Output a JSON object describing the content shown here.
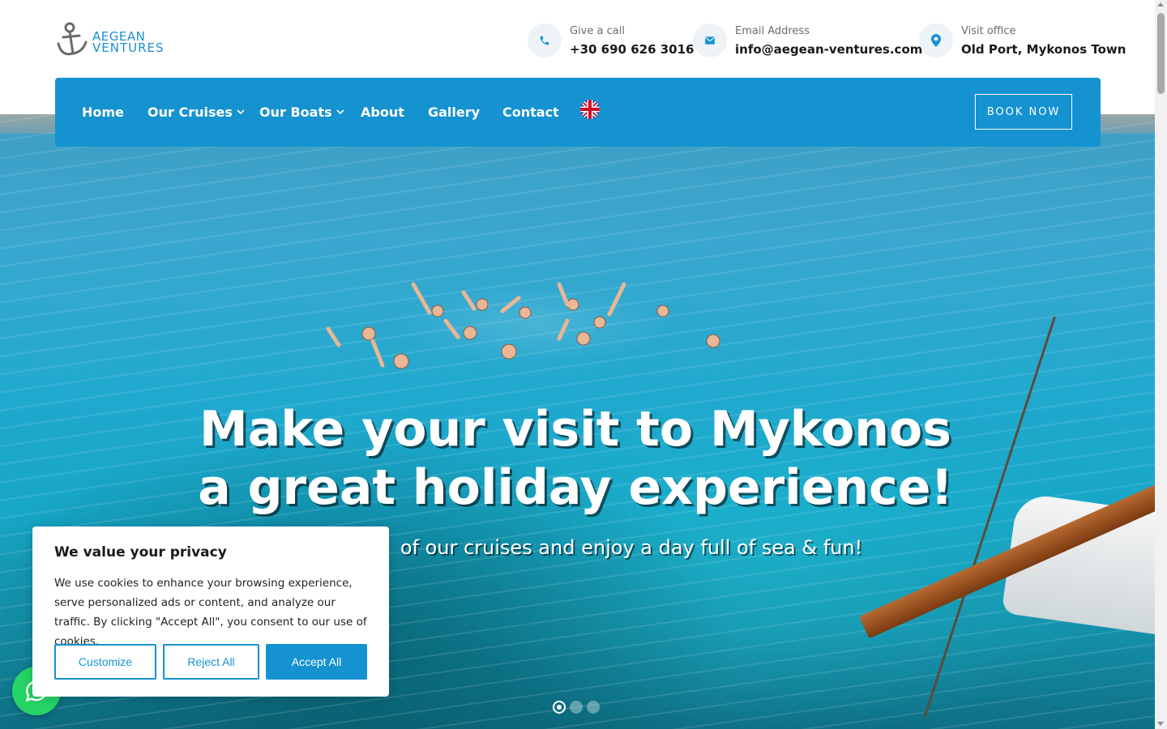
{
  "brand": {
    "line1": "AEGEAN",
    "line2": "VENTURES",
    "accent": "#1592d0"
  },
  "contacts": [
    {
      "icon": "phone-icon",
      "label": "Give a call",
      "value": "+30 690 626 3016"
    },
    {
      "icon": "envelope-icon",
      "label": "Email Address",
      "value": "info@aegean-ventures.com"
    },
    {
      "icon": "map-pin-icon",
      "label": "Visit office",
      "value": "Old Port, Mykonos Town"
    }
  ],
  "nav": {
    "items": [
      {
        "label": "Home",
        "has_dropdown": false
      },
      {
        "label": "Our Cruises",
        "has_dropdown": true
      },
      {
        "label": "Our Boats",
        "has_dropdown": true
      },
      {
        "label": "About",
        "has_dropdown": false
      },
      {
        "label": "Gallery",
        "has_dropdown": false
      },
      {
        "label": "Contact",
        "has_dropdown": false
      }
    ],
    "language_icon": "uk-flag-icon",
    "book_label": "BOOK NOW"
  },
  "hero": {
    "headline_line1": "Make your visit to Mykonos",
    "headline_line2": "a great holiday experience!",
    "subline": "of our cruises and enjoy a day full of sea & fun!",
    "slides": 3,
    "active_slide": 1
  },
  "cookie": {
    "title": "We value your privacy",
    "text": "We use cookies to enhance your browsing experience, serve personalized ads or content, and analyze our traffic. By clicking \"Accept All\", you consent to our use of cookies.",
    "customize": "Customize",
    "reject": "Reject All",
    "accept": "Accept All"
  },
  "whatsapp": {
    "icon": "whatsapp-icon",
    "color": "#25d366"
  }
}
